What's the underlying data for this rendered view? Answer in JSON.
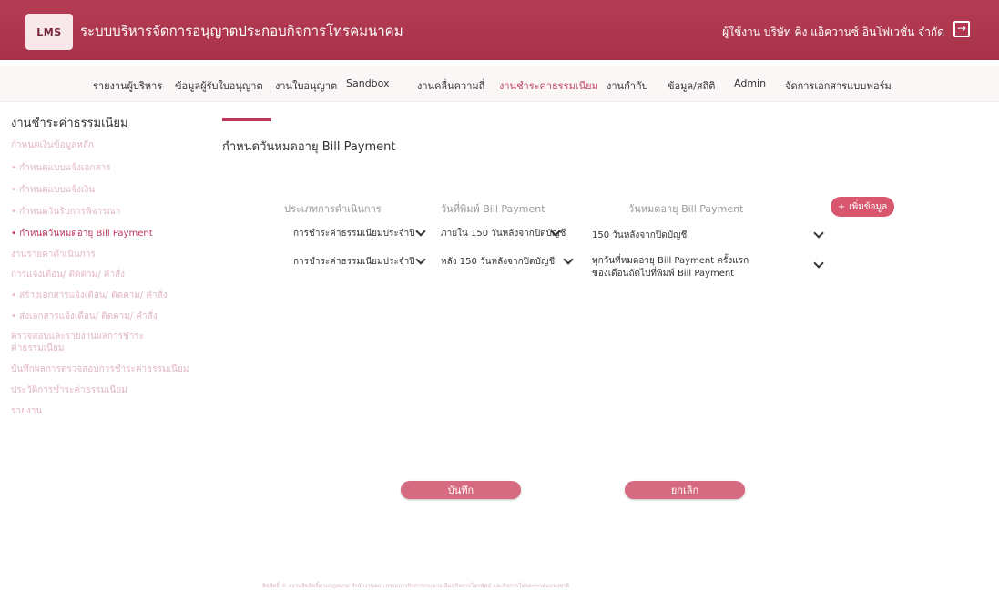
{
  "header": {
    "logo_text": "LMS",
    "app_title": "ระบบบริหารจัดการอนุญาตประกอบกิจการโทรคมนาคม",
    "user_info": "ผู้ใช้งาน บริษัท คิง แอ็ควานซ์ อินโฟเวชั่น จำกัด",
    "logout_icon": "logout-icon"
  },
  "nav": {
    "items": [
      "รายงานผู้บริหาร",
      "ข้อมูลผู้รับใบอนุญาต",
      "งานใบอนุญาต",
      "Sandbox",
      "งานคลื่นความถี่",
      "งานชำระค่าธรรมเนียม",
      "งานกำกับ",
      "ข้อมูล/สถิติ",
      "Admin",
      "จัดการเอกสารแบบฟอร์ม"
    ],
    "active_index": 5
  },
  "sidebar": {
    "title": "งานชำระค่าธรรมเนียม",
    "items": [
      "กำหนดเงินข้อมูลหลัก",
      "• กำหนดแบบแจ้งเอกสาร",
      "• กำหนดแบบแจ้งเงิน",
      "• กำหนดวันรับการพิจารณา",
      "• กำหนดวันหมดอายุ Bill Payment",
      "งานรายค่าดำเนินการ",
      "การแจ้งเตือน/ ติดตาม/ คำสั่ง",
      "• สร้างเอกสารแจ้งเตือน/ ติดตาม/ คำสั่ง",
      "• ส่งเอกสารแจ้งเตือน/ ติดตาม/ คำสั่ง",
      "ตรวจสอบและรายงานผลการชำระ",
      "ค่าธรรมเนียม",
      "บันทึกผลการตรวจสอบการชำระค่าธรรมเนียม",
      "ประวัติการชำระค่าธรรมเนียม",
      "รายงาน"
    ],
    "active_index": 4
  },
  "main": {
    "title": "กำหนดวันหมดอายุ Bill Payment",
    "columns": [
      "ประเภทการดำเนินการ",
      "วันที่พิมพ์ Bill Payment",
      "วันหมดอายุ Bill Payment"
    ],
    "add_button": "เพิ่มข้อมูล",
    "rows": [
      {
        "type": "การชำระค่าธรรมเนียมประจำปี",
        "print_date": "ภายใน 150 วันหลังจากปิดบัญชี",
        "expiry": [
          "150 วันหลังจากปิดบัญชี"
        ]
      },
      {
        "type": "การชำระค่าธรรมเนียมประจำปี",
        "print_date": "หลัง 150 วันหลังจากปิดบัญชี",
        "expiry": [
          "ทุกวันที่หมดอายุ Bill Payment ครั้งแรก",
          "ของเดือนถัดไปที่พิมพ์ Bill Payment"
        ]
      }
    ],
    "save_button": "บันทึก",
    "cancel_button": "ยกเลิก"
  },
  "footer": {
    "text": "ลิขสิทธิ์ © สงวนลิขสิทธิ์ตามกฎหมาย สำนักงานคณะกรรมการกิจการกระจายเสียง กิจการโทรทัศน์ และกิจการโทรคมนาคมแห่งชาติ"
  },
  "colors": {
    "brand": "#b43d55",
    "accent": "#c1375a",
    "button": "#d66a80"
  }
}
